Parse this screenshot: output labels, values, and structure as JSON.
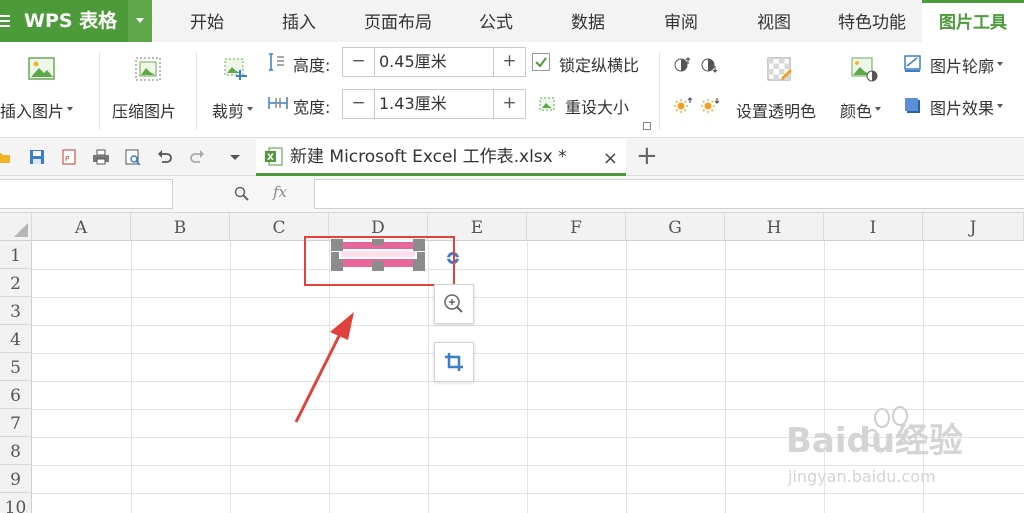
{
  "app": {
    "title": "WPS 表格"
  },
  "tabs": [
    {
      "label": "开始"
    },
    {
      "label": "插入"
    },
    {
      "label": "页面布局"
    },
    {
      "label": "公式"
    },
    {
      "label": "数据"
    },
    {
      "label": "审阅"
    },
    {
      "label": "视图"
    },
    {
      "label": "特色功能"
    },
    {
      "label": "图片工具"
    }
  ],
  "ribbon": {
    "insert_picture": "插入图片",
    "compress_picture": "压缩图片",
    "crop": "裁剪",
    "height_label": "高度:",
    "height_value": "0.45厘米",
    "width_label": "宽度:",
    "width_value": "1.43厘米",
    "minus": "−",
    "plus": "+",
    "lock_ratio": "锁定纵横比",
    "reset_size": "重设大小",
    "set_transparent": "设置透明色",
    "color": "颜色",
    "outline": "图片轮廓",
    "effects": "图片效果"
  },
  "document": {
    "tab_name": "新建 Microsoft Excel 工作表.xlsx *",
    "close": "×",
    "new_tab": "+"
  },
  "formula_bar": {
    "fx": "fx"
  },
  "columns": [
    "A",
    "B",
    "C",
    "D",
    "E",
    "F",
    "G",
    "H",
    "I",
    "J"
  ],
  "rows": [
    "1",
    "2",
    "3",
    "4",
    "5",
    "6",
    "7",
    "8",
    "9",
    "10"
  ],
  "watermark": {
    "brand": "Baidu经验",
    "url": "jingyan.baidu.com"
  },
  "colors": {
    "accent": "#4c9a3a",
    "highlight_box": "#e0433b",
    "arrow": "#e0433b"
  }
}
